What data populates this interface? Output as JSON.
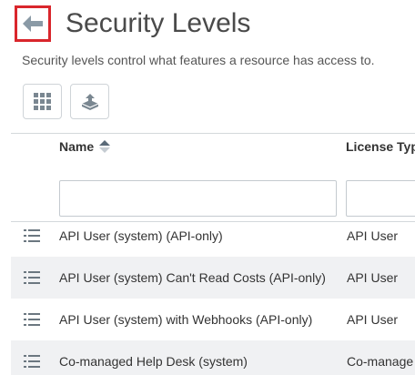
{
  "header": {
    "title": "Security Levels",
    "subtitle": "Security levels control what features a resource has access to."
  },
  "toolbar": {
    "buttons": [
      {
        "icon": "grid-icon"
      },
      {
        "icon": "export-icon"
      }
    ]
  },
  "table": {
    "columns": [
      {
        "label": "Name",
        "sort": "ascending"
      },
      {
        "label": "License Typ"
      }
    ],
    "filters": {
      "name_value": "",
      "license_value": ""
    },
    "rows": [
      {
        "name": "API User (system) (API-only)",
        "license": "API User"
      },
      {
        "name": "API User (system) Can't Read Costs (API-only)",
        "license": "API User"
      },
      {
        "name": "API User (system) with Webhooks (API-only)",
        "license": "API User"
      },
      {
        "name": "Co-managed Help Desk (system)",
        "license": "Co-manage"
      }
    ]
  },
  "colors": {
    "highlight_border": "#d9262c",
    "icon_gray": "#7a8791",
    "row_alt": "#f0f1f3"
  }
}
